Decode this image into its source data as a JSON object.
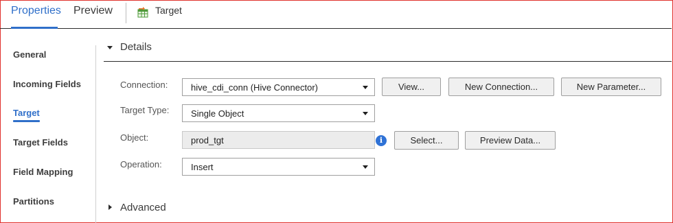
{
  "tabs": {
    "properties_label": "Properties",
    "preview_label": "Preview",
    "target_label": "Target",
    "target_icon": "table-target-icon"
  },
  "sidebar": {
    "items": [
      {
        "label": "General",
        "active": false
      },
      {
        "label": "Incoming Fields",
        "active": false
      },
      {
        "label": "Target",
        "active": true
      },
      {
        "label": "Target Fields",
        "active": false
      },
      {
        "label": "Field Mapping",
        "active": false
      },
      {
        "label": "Partitions",
        "active": false
      }
    ]
  },
  "details": {
    "title": "Details",
    "connection": {
      "label": "Connection:",
      "value": "hive_cdi_conn (Hive Connector)",
      "view_button": "View...",
      "new_connection_button": "New Connection...",
      "new_parameter_button": "New Parameter..."
    },
    "target_type": {
      "label": "Target Type:",
      "value": "Single Object"
    },
    "object": {
      "label": "Object:",
      "value": "prod_tgt",
      "info_icon": "info-icon",
      "select_button": "Select...",
      "preview_data_button": "Preview Data..."
    },
    "operation": {
      "label": "Operation:",
      "value": "Insert"
    }
  },
  "advanced": {
    "title": "Advanced"
  },
  "colors": {
    "accent": "#2f6fc9",
    "frame_border": "#e0312c",
    "info_icon": "#2f72d6"
  }
}
